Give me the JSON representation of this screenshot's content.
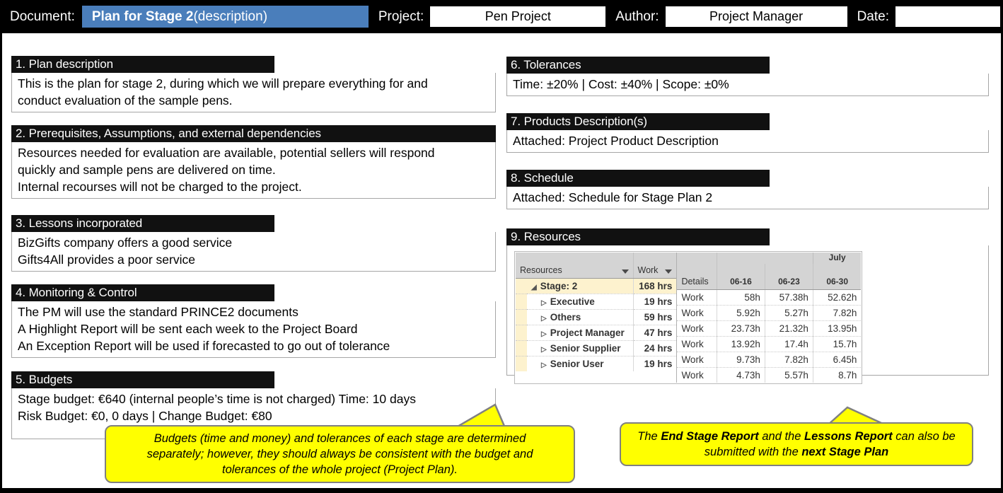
{
  "header": {
    "document_label": "Document:",
    "document_title_bold": "Plan for Stage 2",
    "document_title_rest": " (description)",
    "project_label": "Project:",
    "project_value": "Pen Project",
    "author_label": "Author:",
    "author_value": "Project Manager",
    "date_label": "Date:",
    "date_value": "",
    "accent_color": "#4a7ebb"
  },
  "sections": {
    "s1": {
      "title": "1. Plan description",
      "lines": [
        "This is the plan for stage 2, during which we will prepare everything for and",
        "conduct evaluation of the sample pens."
      ]
    },
    "s2": {
      "title": "2. Prerequisites, Assumptions, and external dependencies",
      "lines": [
        "Resources needed for evaluation are available, potential sellers will respond",
        "quickly and sample pens are delivered on time.",
        "Internal recourses will not be charged to the project."
      ]
    },
    "s3": {
      "title": "3. Lessons incorporated",
      "lines": [
        "BizGifts company offers a good service",
        "Gifts4All provides a poor service"
      ]
    },
    "s4": {
      "title": "4. Monitoring & Control",
      "lines": [
        "The PM will use the standard PRINCE2 documents",
        "A Highlight Report will be sent each week to the Project Board",
        "An Exception Report will be used if forecasted to go out of tolerance"
      ]
    },
    "s5": {
      "title": "5. Budgets",
      "lines": [
        "Stage budget: €640 (internal people’s time is not charged) Time: 10 days",
        "Risk Budget: €0, 0 days | Change Budget: €80"
      ]
    },
    "s6": {
      "title": "6. Tolerances",
      "lines": [
        "Time: ±20% | Cost: ±40% | Scope: ±0%"
      ]
    },
    "s7": {
      "title": "7. Products Description(s)",
      "lines": [
        "Attached: Project Product Description"
      ]
    },
    "s8": {
      "title": "8. Schedule",
      "lines": [
        "Attached: Schedule for Stage Plan 2"
      ]
    },
    "s9": {
      "title": "9. Resources"
    }
  },
  "resources_table": {
    "col_resources": "Resources",
    "col_work": "Work",
    "col_details": "Details",
    "month_label": "July",
    "date_columns": [
      "06-16",
      "06-23",
      "06-30"
    ],
    "rows": [
      {
        "name": "Stage: 2",
        "work": "168 hrs",
        "details": "Work",
        "values": [
          "58h",
          "57.38h",
          "52.62h"
        ],
        "level": 0,
        "twisty": "◢"
      },
      {
        "name": "Executive",
        "work": "19 hrs",
        "details": "Work",
        "values": [
          "5.92h",
          "5.27h",
          "7.82h"
        ],
        "level": 1,
        "twisty": "▷"
      },
      {
        "name": "Others",
        "work": "59 hrs",
        "details": "Work",
        "values": [
          "23.73h",
          "21.32h",
          "13.95h"
        ],
        "level": 1,
        "twisty": "▷"
      },
      {
        "name": "Project Manager",
        "work": "47 hrs",
        "details": "Work",
        "values": [
          "13.92h",
          "17.4h",
          "15.7h"
        ],
        "level": 1,
        "twisty": "▷"
      },
      {
        "name": "Senior Supplier",
        "work": "24 hrs",
        "details": "Work",
        "values": [
          "9.73h",
          "7.82h",
          "6.45h"
        ],
        "level": 1,
        "twisty": "▷"
      },
      {
        "name": "Senior User",
        "work": "19 hrs",
        "details": "Work",
        "values": [
          "4.73h",
          "5.57h",
          "8.7h"
        ],
        "level": 1,
        "twisty": "▷"
      }
    ]
  },
  "callouts": {
    "left": {
      "line1": "Budgets (time and money) and tolerances of each stage are determined",
      "line2": "separately; however, they should always be consistent with the budget and",
      "line3": "tolerances of the whole project (Project Plan).",
      "color": "#ffff00"
    },
    "right": {
      "pre1": "The ",
      "bold1": "End Stage Report",
      "mid1": " and the ",
      "bold2": "Lessons Report",
      "post1": " can also be",
      "pre2": "submitted with the ",
      "bold3": "next Stage Plan",
      "color": "#ffff00"
    }
  }
}
